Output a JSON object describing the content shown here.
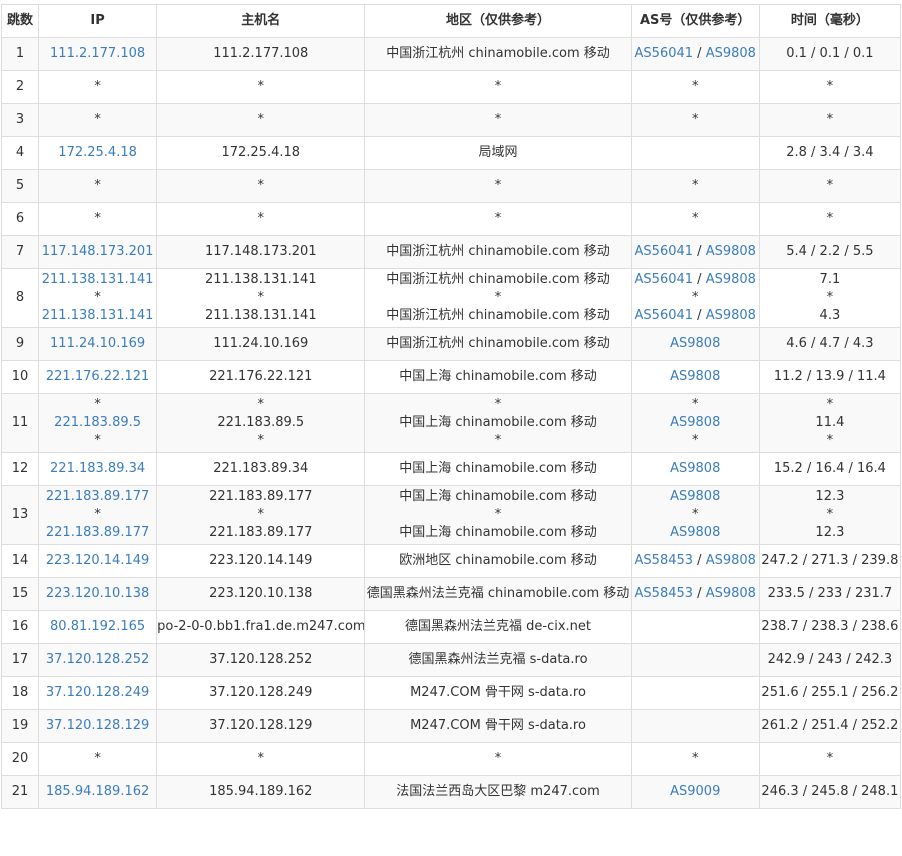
{
  "headers": [
    "跳数",
    "IP",
    "主机名",
    "地区（仅供参考）",
    "AS号（仅供参考）",
    "时间（毫秒）"
  ],
  "hops": [
    {
      "hop": "1",
      "lines": [
        {
          "ip": "111.2.177.108",
          "host": "111.2.177.108",
          "loc": "中国浙江杭州 chinamobile.com 移动",
          "as": [
            "AS56041",
            "AS9808"
          ]
        }
      ],
      "time": [
        "0.1 / 0.1 / 0.1"
      ]
    },
    {
      "hop": "2",
      "lines": [
        {
          "ip": "*",
          "host": "*",
          "loc": "*",
          "as": [
            "*"
          ]
        }
      ],
      "time": [
        "*"
      ]
    },
    {
      "hop": "3",
      "lines": [
        {
          "ip": "*",
          "host": "*",
          "loc": "*",
          "as": [
            "*"
          ]
        }
      ],
      "time": [
        "*"
      ]
    },
    {
      "hop": "4",
      "lines": [
        {
          "ip": "172.25.4.18",
          "host": "172.25.4.18",
          "loc": "局域网",
          "as": []
        }
      ],
      "time": [
        "2.8 / 3.4 / 3.4"
      ]
    },
    {
      "hop": "5",
      "lines": [
        {
          "ip": "*",
          "host": "*",
          "loc": "*",
          "as": [
            "*"
          ]
        }
      ],
      "time": [
        "*"
      ]
    },
    {
      "hop": "6",
      "lines": [
        {
          "ip": "*",
          "host": "*",
          "loc": "*",
          "as": [
            "*"
          ]
        }
      ],
      "time": [
        "*"
      ]
    },
    {
      "hop": "7",
      "lines": [
        {
          "ip": "117.148.173.201",
          "host": "117.148.173.201",
          "loc": "中国浙江杭州 chinamobile.com 移动",
          "as": [
            "AS56041",
            "AS9808"
          ]
        }
      ],
      "time": [
        "5.4 / 2.2 / 5.5"
      ]
    },
    {
      "hop": "8",
      "lines": [
        {
          "ip": "211.138.131.141",
          "host": "211.138.131.141",
          "loc": "中国浙江杭州 chinamobile.com 移动",
          "as": [
            "AS56041",
            "AS9808"
          ]
        },
        {
          "ip": "*",
          "host": "*",
          "loc": "*",
          "as": [
            "*"
          ]
        },
        {
          "ip": "211.138.131.141",
          "host": "211.138.131.141",
          "loc": "中国浙江杭州 chinamobile.com 移动",
          "as": [
            "AS56041",
            "AS9808"
          ]
        }
      ],
      "time": [
        "7.1",
        "*",
        "4.3"
      ]
    },
    {
      "hop": "9",
      "lines": [
        {
          "ip": "111.24.10.169",
          "host": "111.24.10.169",
          "loc": "中国浙江杭州 chinamobile.com 移动",
          "as": [
            "AS9808"
          ]
        }
      ],
      "time": [
        "4.6 / 4.7 / 4.3"
      ]
    },
    {
      "hop": "10",
      "lines": [
        {
          "ip": "221.176.22.121",
          "host": "221.176.22.121",
          "loc": "中国上海 chinamobile.com 移动",
          "as": [
            "AS9808"
          ]
        }
      ],
      "time": [
        "11.2 / 13.9 / 11.4"
      ]
    },
    {
      "hop": "11",
      "lines": [
        {
          "ip": "*",
          "host": "*",
          "loc": "*",
          "as": [
            "*"
          ]
        },
        {
          "ip": "221.183.89.5",
          "host": "221.183.89.5",
          "loc": "中国上海 chinamobile.com 移动",
          "as": [
            "AS9808"
          ]
        },
        {
          "ip": "*",
          "host": "*",
          "loc": "*",
          "as": [
            "*"
          ]
        }
      ],
      "time": [
        "*",
        "11.4",
        "*"
      ]
    },
    {
      "hop": "12",
      "lines": [
        {
          "ip": "221.183.89.34",
          "host": "221.183.89.34",
          "loc": "中国上海 chinamobile.com 移动",
          "as": [
            "AS9808"
          ]
        }
      ],
      "time": [
        "15.2 / 16.4 / 16.4"
      ]
    },
    {
      "hop": "13",
      "lines": [
        {
          "ip": "221.183.89.177",
          "host": "221.183.89.177",
          "loc": "中国上海 chinamobile.com 移动",
          "as": [
            "AS9808"
          ]
        },
        {
          "ip": "*",
          "host": "*",
          "loc": "*",
          "as": [
            "*"
          ]
        },
        {
          "ip": "221.183.89.177",
          "host": "221.183.89.177",
          "loc": "中国上海 chinamobile.com 移动",
          "as": [
            "AS9808"
          ]
        }
      ],
      "time": [
        "12.3",
        "*",
        "12.3"
      ]
    },
    {
      "hop": "14",
      "lines": [
        {
          "ip": "223.120.14.149",
          "host": "223.120.14.149",
          "loc": "欧洲地区 chinamobile.com 移动",
          "as": [
            "AS58453",
            "AS9808"
          ]
        }
      ],
      "time": [
        "247.2 / 271.3 / 239.8"
      ]
    },
    {
      "hop": "15",
      "lines": [
        {
          "ip": "223.120.10.138",
          "host": "223.120.10.138",
          "loc": "德国黑森州法兰克福 chinamobile.com 移动",
          "as": [
            "AS58453",
            "AS9808"
          ]
        }
      ],
      "time": [
        "233.5 / 233 / 231.7"
      ]
    },
    {
      "hop": "16",
      "lines": [
        {
          "ip": "80.81.192.165",
          "host": "po-2-0-0.bb1.fra1.de.m247.com",
          "loc": "德国黑森州法兰克福 de-cix.net",
          "as": []
        }
      ],
      "time": [
        "238.7 / 238.3 / 238.6"
      ]
    },
    {
      "hop": "17",
      "lines": [
        {
          "ip": "37.120.128.252",
          "host": "37.120.128.252",
          "loc": "德国黑森州法兰克福 s-data.ro",
          "as": []
        }
      ],
      "time": [
        "242.9 / 243 / 242.3"
      ]
    },
    {
      "hop": "18",
      "lines": [
        {
          "ip": "37.120.128.249",
          "host": "37.120.128.249",
          "loc": "M247.COM 骨干网 s-data.ro",
          "as": []
        }
      ],
      "time": [
        "251.6 / 255.1 / 256.2"
      ]
    },
    {
      "hop": "19",
      "lines": [
        {
          "ip": "37.120.128.129",
          "host": "37.120.128.129",
          "loc": "M247.COM 骨干网 s-data.ro",
          "as": []
        }
      ],
      "time": [
        "261.2 / 251.4 / 252.2"
      ]
    },
    {
      "hop": "20",
      "lines": [
        {
          "ip": "*",
          "host": "*",
          "loc": "*",
          "as": [
            "*"
          ]
        }
      ],
      "time": [
        "*"
      ]
    },
    {
      "hop": "21",
      "lines": [
        {
          "ip": "185.94.189.162",
          "host": "185.94.189.162",
          "loc": "法国法兰西岛大区巴黎 m247.com",
          "as": [
            "AS9009"
          ]
        }
      ],
      "time": [
        "246.3 / 245.8 / 248.1"
      ]
    }
  ],
  "colors": {
    "link": "#3a7dbf",
    "border": "#dddddd",
    "stripe": "#f9f9f9",
    "text": "#333333"
  }
}
